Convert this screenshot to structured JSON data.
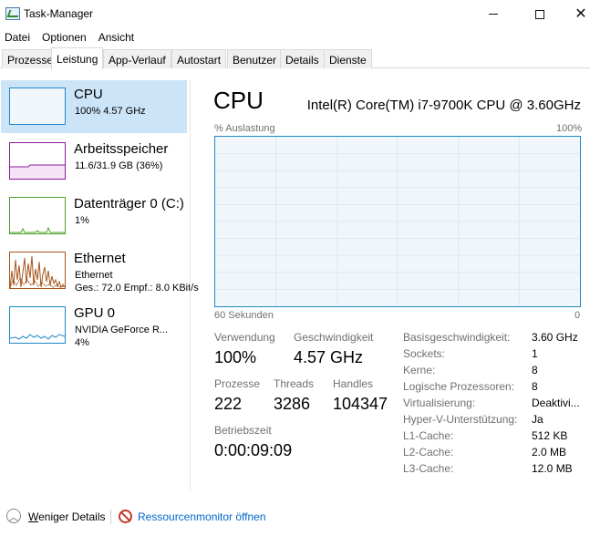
{
  "window": {
    "title": "Task-Manager",
    "minimize_glyph": "",
    "close_glyph": "✕"
  },
  "menu": [
    "Datei",
    "Optionen",
    "Ansicht"
  ],
  "tabs": [
    {
      "label": "Prozesse",
      "active": false
    },
    {
      "label": "Leistung",
      "active": true
    },
    {
      "label": "App-Verlauf",
      "active": false
    },
    {
      "label": "Autostart",
      "active": false
    },
    {
      "label": "Benutzer",
      "active": false
    },
    {
      "label": "Details",
      "active": false
    },
    {
      "label": "Dienste",
      "active": false
    }
  ],
  "resources": [
    {
      "name": "CPU",
      "line1": "100% 4.57 GHz",
      "line2": "",
      "color": "#1e88c8",
      "selected": true
    },
    {
      "name": "Arbeitsspeicher",
      "line1": "11.6/31.9 GB (36%)",
      "line2": "",
      "color": "#8b1a9a",
      "selected": false
    },
    {
      "name": "Datenträger 0 (C:)",
      "line1": "1%",
      "line2": "",
      "color": "#4ca32a",
      "selected": false
    },
    {
      "name": "Ethernet",
      "line1": "Ethernet",
      "line2": "Ges.: 72.0 Empf.: 8.0 KBit/s",
      "color": "#a7541c",
      "selected": false
    },
    {
      "name": "GPU 0",
      "line1": "NVIDIA GeForce R...",
      "line2": "4%",
      "color": "#1e88c8",
      "selected": false
    }
  ],
  "main": {
    "heading": "CPU",
    "model": "Intel(R) Core(TM) i7-9700K CPU @ 3.60GHz",
    "graph_top_left": "% Auslastung",
    "graph_top_right": "100%",
    "graph_bottom_left": "60 Sekunden",
    "graph_bottom_right": "0",
    "utilization_percent": 100
  },
  "stats": {
    "verwendung_label": "Verwendung",
    "verwendung_value": "100%",
    "geschwindigkeit_label": "Geschwindigkeit",
    "geschwindigkeit_value": "4.57 GHz",
    "prozesse_label": "Prozesse",
    "prozesse_value": "222",
    "threads_label": "Threads",
    "threads_value": "3286",
    "handles_label": "Handles",
    "handles_value": "104347",
    "betriebszeit_label": "Betriebszeit",
    "betriebszeit_value": "0:00:09:09"
  },
  "details": [
    {
      "label": "Basisgeschwindigkeit:",
      "value": "3.60 GHz"
    },
    {
      "label": "Sockets:",
      "value": "1"
    },
    {
      "label": "Kerne:",
      "value": "8"
    },
    {
      "label": "Logische Prozessoren:",
      "value": "8"
    },
    {
      "label": "Virtualisierung:",
      "value": "Deaktivi..."
    },
    {
      "label": "Hyper-V-Unterstützung:",
      "value": "Ja"
    },
    {
      "label": "L1-Cache:",
      "value": "512 KB"
    },
    {
      "label": "L2-Cache:",
      "value": "2.0 MB"
    },
    {
      "label": "L3-Cache:",
      "value": "12.0 MB"
    }
  ],
  "footer": {
    "fewer_details": "Weniger Details",
    "resource_monitor": "Ressourcenmonitor öffnen"
  }
}
